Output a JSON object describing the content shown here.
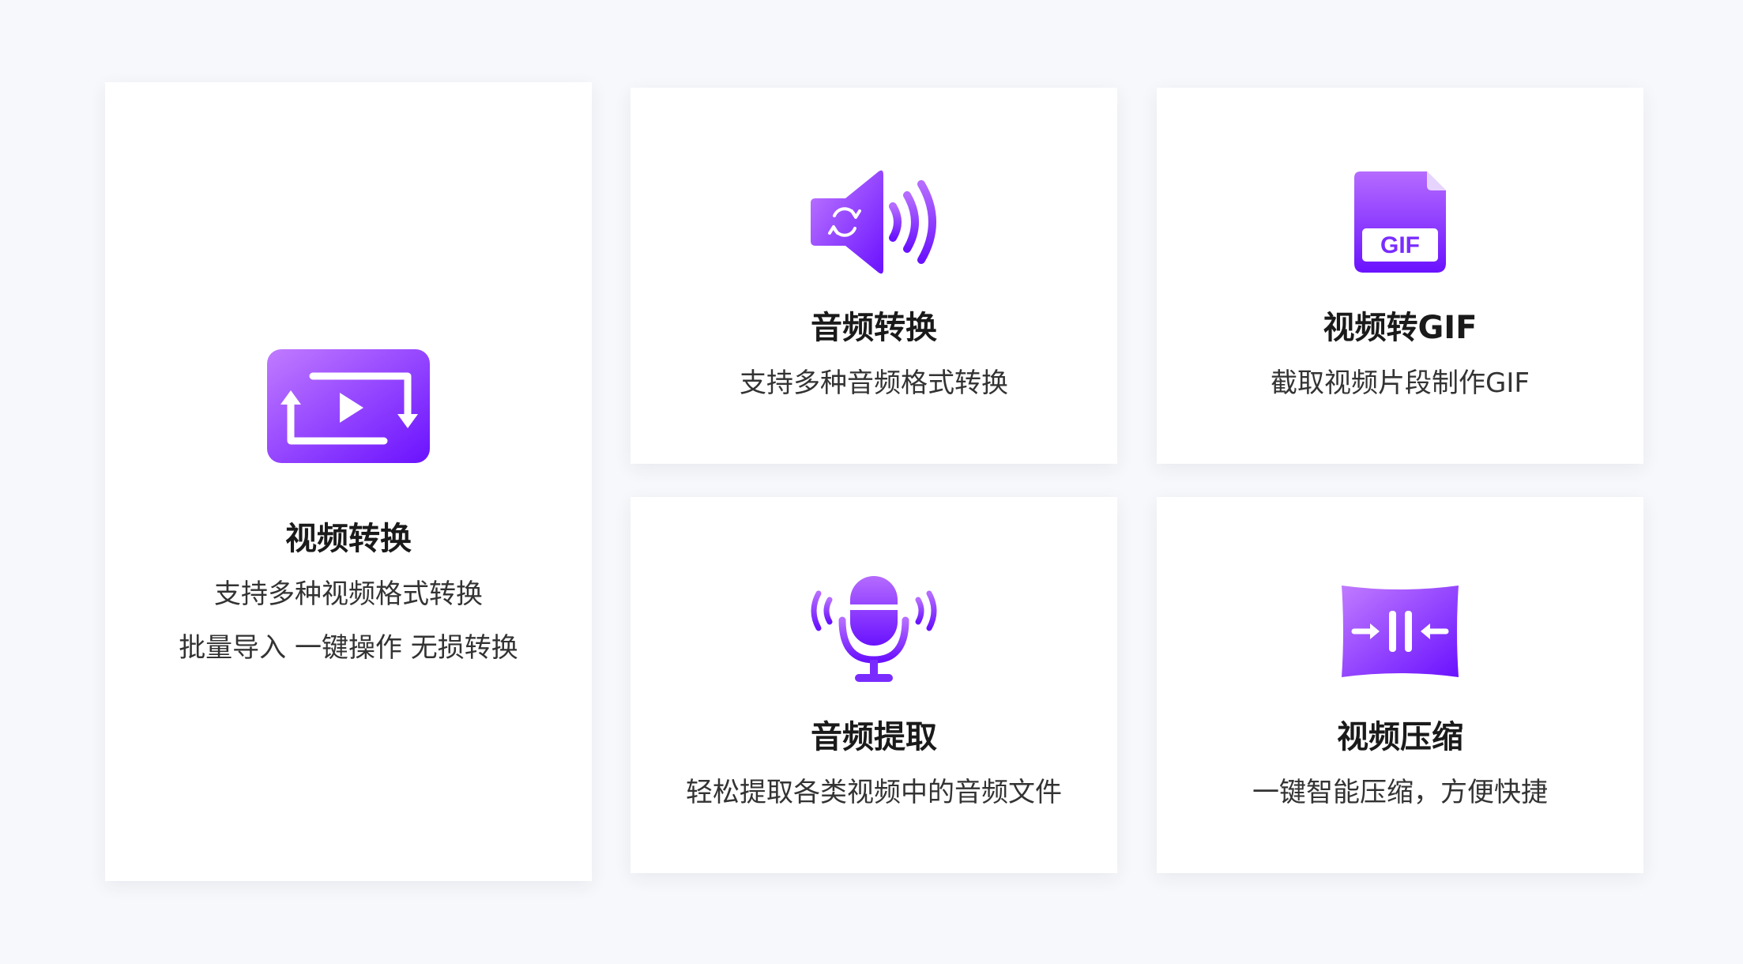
{
  "theme": {
    "accent_start": "#b260ff",
    "accent_end": "#6a1bff",
    "background": "#f7f8fb",
    "card_background": "#ffffff"
  },
  "features": {
    "video_convert": {
      "icon": "video-convert-icon",
      "title": "视频转换",
      "desc_line1": "支持多种视频格式转换",
      "desc_line2": "批量导入 一键操作 无损转换"
    },
    "audio_convert": {
      "icon": "audio-convert-icon",
      "title": "音频转换",
      "desc": "支持多种音频格式转换"
    },
    "video_gif": {
      "icon": "gif-file-icon",
      "icon_text": "GIF",
      "title": "视频转GIF",
      "desc": "截取视频片段制作GIF"
    },
    "audio_extract": {
      "icon": "microphone-icon",
      "title": "音频提取",
      "desc": "轻松提取各类视频中的音频文件"
    },
    "video_compress": {
      "icon": "video-compress-icon",
      "title": "视频压缩",
      "desc": "一键智能压缩，方便快捷"
    }
  }
}
